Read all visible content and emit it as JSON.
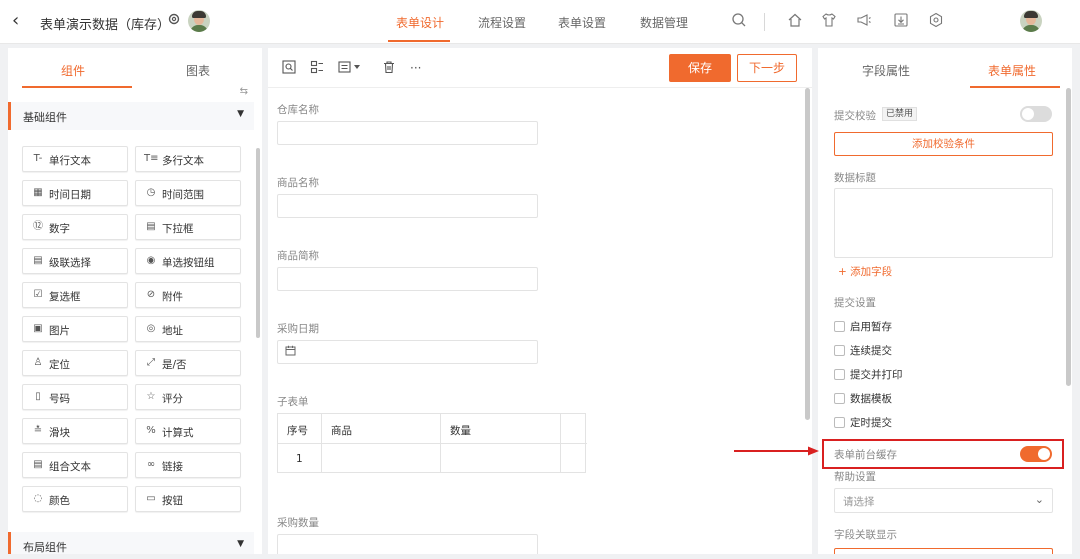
{
  "header": {
    "back_icon": "chevron-left-icon",
    "title": "表单演示数据（库存）",
    "nav_tabs": [
      {
        "label": "表单设计",
        "active": true
      },
      {
        "label": "流程设置",
        "active": false
      },
      {
        "label": "表单设置",
        "active": false
      },
      {
        "label": "数据管理",
        "active": false
      }
    ],
    "toolbar_icons": [
      "search-icon",
      "home-icon",
      "shirt-icon",
      "announce-icon",
      "download-icon",
      "plugin-icon"
    ]
  },
  "left": {
    "tabs": [
      {
        "label": "组件",
        "active": true
      },
      {
        "label": "图表",
        "active": false
      }
    ],
    "sections": [
      {
        "label": "基础组件"
      },
      {
        "label": "布局组件"
      }
    ],
    "components": [
      {
        "label": "单行文本",
        "icon": "T-"
      },
      {
        "label": "多行文本",
        "icon": "T≡"
      },
      {
        "label": "时间日期",
        "icon": "▦"
      },
      {
        "label": "时间范围",
        "icon": "◷"
      },
      {
        "label": "数字",
        "icon": "⑫"
      },
      {
        "label": "下拉框",
        "icon": "▤"
      },
      {
        "label": "级联选择",
        "icon": "▤"
      },
      {
        "label": "单选按钮组",
        "icon": "◉"
      },
      {
        "label": "复选框",
        "icon": "☑"
      },
      {
        "label": "附件",
        "icon": "⊘"
      },
      {
        "label": "图片",
        "icon": "▣"
      },
      {
        "label": "地址",
        "icon": "◎"
      },
      {
        "label": "定位",
        "icon": "♙"
      },
      {
        "label": "是/否",
        "icon": "⤢"
      },
      {
        "label": "号码",
        "icon": "▯"
      },
      {
        "label": "评分",
        "icon": "☆"
      },
      {
        "label": "滑块",
        "icon": "≛"
      },
      {
        "label": "计算式",
        "icon": "%"
      },
      {
        "label": "组合文本",
        "icon": "▤"
      },
      {
        "label": "链接",
        "icon": "∞"
      },
      {
        "label": "颜色",
        "icon": "◌"
      },
      {
        "label": "按钮",
        "icon": "▭"
      }
    ]
  },
  "center": {
    "toolbar": {
      "save_label": "保存",
      "next_label": "下一步",
      "more_label": "···"
    },
    "fields": [
      {
        "label": "仓库名称"
      },
      {
        "label": "商品名称"
      },
      {
        "label": "商品简称"
      },
      {
        "label": "采购日期"
      },
      {
        "label": "子表单"
      },
      {
        "label": "采购数量"
      }
    ],
    "subtable": {
      "headers": [
        "序号",
        "商品",
        "数量"
      ],
      "rows": [
        [
          "1",
          "",
          ""
        ]
      ]
    }
  },
  "right": {
    "tabs": [
      {
        "label": "字段属性",
        "active": false
      },
      {
        "label": "表单属性",
        "active": true
      }
    ],
    "submit_validate_label": "提交校验",
    "disabled_badge": "已禁用",
    "submit_validate_enabled": false,
    "add_rule_label": "添加校验条件",
    "data_title_label": "数据标题",
    "add_field_label": "+ 添加字段",
    "submit_settings_label": "提交设置",
    "checkboxes": [
      {
        "label": "启用暂存",
        "checked": false
      },
      {
        "label": "连续提交",
        "checked": false
      },
      {
        "label": "提交并打印",
        "checked": false
      },
      {
        "label": "数据模板",
        "checked": false
      },
      {
        "label": "定时提交",
        "checked": false
      }
    ],
    "cache_label": "表单前台缓存",
    "cache_enabled": true,
    "help_label": "帮助设置",
    "help_placeholder": "请选择",
    "linked_display_label": "字段关联显示"
  },
  "colors": {
    "accent": "#f06a2e",
    "annotation": "#d92020"
  }
}
